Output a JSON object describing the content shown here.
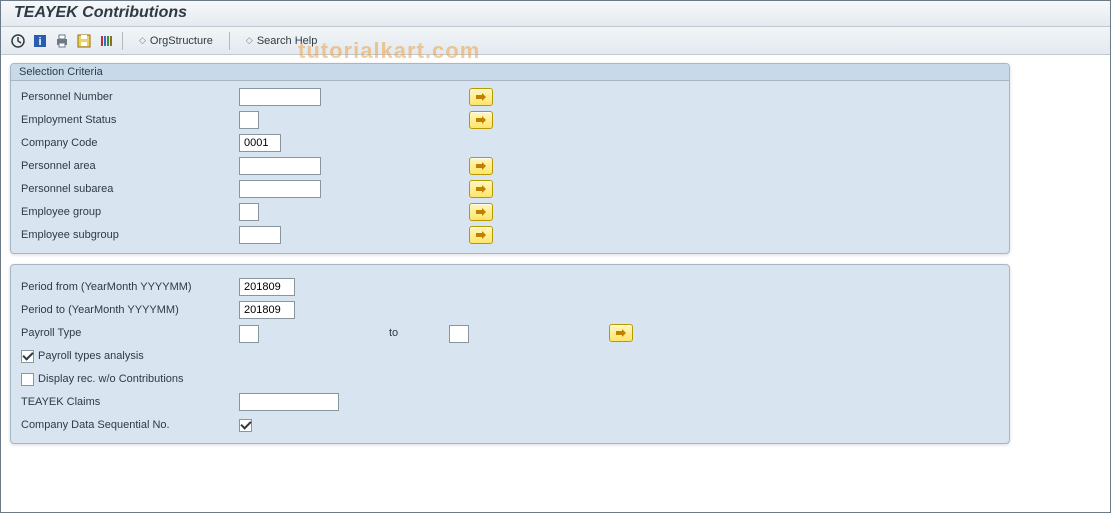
{
  "title": "TEAYEK Contributions",
  "watermark": "tutorialkart.com",
  "toolbar": {
    "org_structure": "OrgStructure",
    "search_help": "Search Help"
  },
  "group1": {
    "title": "Selection Criteria",
    "rows": {
      "personnel_number": {
        "label": "Personnel Number",
        "value": ""
      },
      "employment_status": {
        "label": "Employment Status",
        "value": ""
      },
      "company_code": {
        "label": "Company Code",
        "value": "0001"
      },
      "personnel_area": {
        "label": "Personnel area",
        "value": ""
      },
      "personnel_subarea": {
        "label": "Personnel subarea",
        "value": ""
      },
      "employee_group": {
        "label": "Employee group",
        "value": ""
      },
      "employee_subgroup": {
        "label": "Employee subgroup",
        "value": ""
      }
    }
  },
  "group2": {
    "period_from": {
      "label": "Period from (YearMonth YYYYMM)",
      "value": "201809"
    },
    "period_to": {
      "label": "Period to (YearMonth YYYYMM)",
      "value": "201809"
    },
    "payroll_type": {
      "label": "Payroll Type",
      "value_from": "",
      "to_label": "to",
      "value_to": ""
    },
    "payroll_types_analysis": {
      "label": "Payroll types analysis",
      "checked": true
    },
    "display_rec": {
      "label": "Display rec. w/o Contributions",
      "checked": false
    },
    "teayek_claims": {
      "label": "TEAYEK Claims",
      "value": ""
    },
    "company_seq": {
      "label": "Company Data Sequential No.",
      "checked": true
    }
  }
}
